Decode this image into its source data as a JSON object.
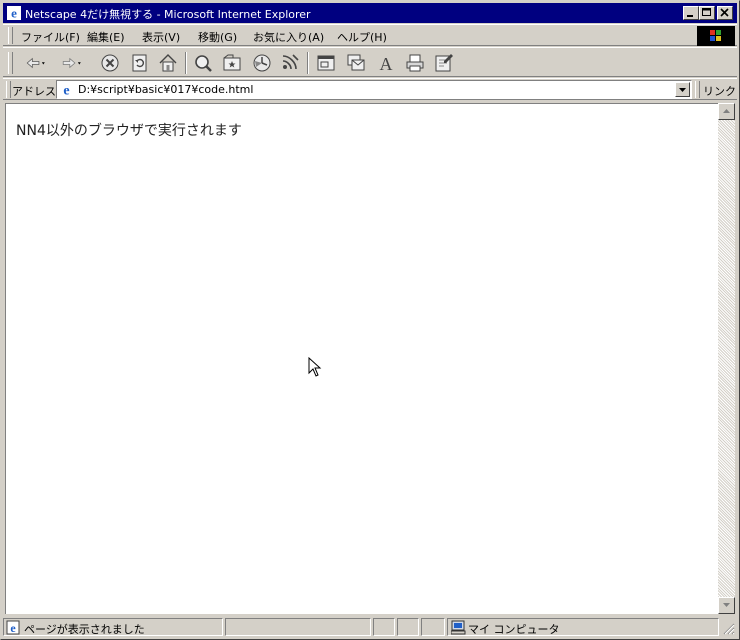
{
  "window": {
    "title": "Netscape 4だけ無視する - Microsoft Internet Explorer"
  },
  "menu": {
    "items": [
      "ファイル(F)",
      "編集(E)",
      "表示(V)",
      "移動(G)",
      "お気に入り(A)",
      "ヘルプ(H)"
    ]
  },
  "toolbar": {
    "buttons": [
      "back-icon",
      "forward-icon",
      "stop-icon",
      "refresh-icon",
      "home-icon",
      "search-icon",
      "favorites-icon",
      "history-icon",
      "channels-icon",
      "fullscreen-icon",
      "mail-icon",
      "font-icon",
      "print-icon",
      "edit-icon"
    ]
  },
  "address": {
    "label": "アドレス",
    "value": "D:¥script¥basic¥017¥code.html",
    "links_label": "リンク"
  },
  "content": {
    "text": "NN4以外のブラウザで実行されます"
  },
  "status": {
    "text": "ページが表示されました",
    "zone": "マイ コンピュータ"
  },
  "colors": {
    "titlebar": "#000080",
    "chrome": "#d4d0c8"
  }
}
